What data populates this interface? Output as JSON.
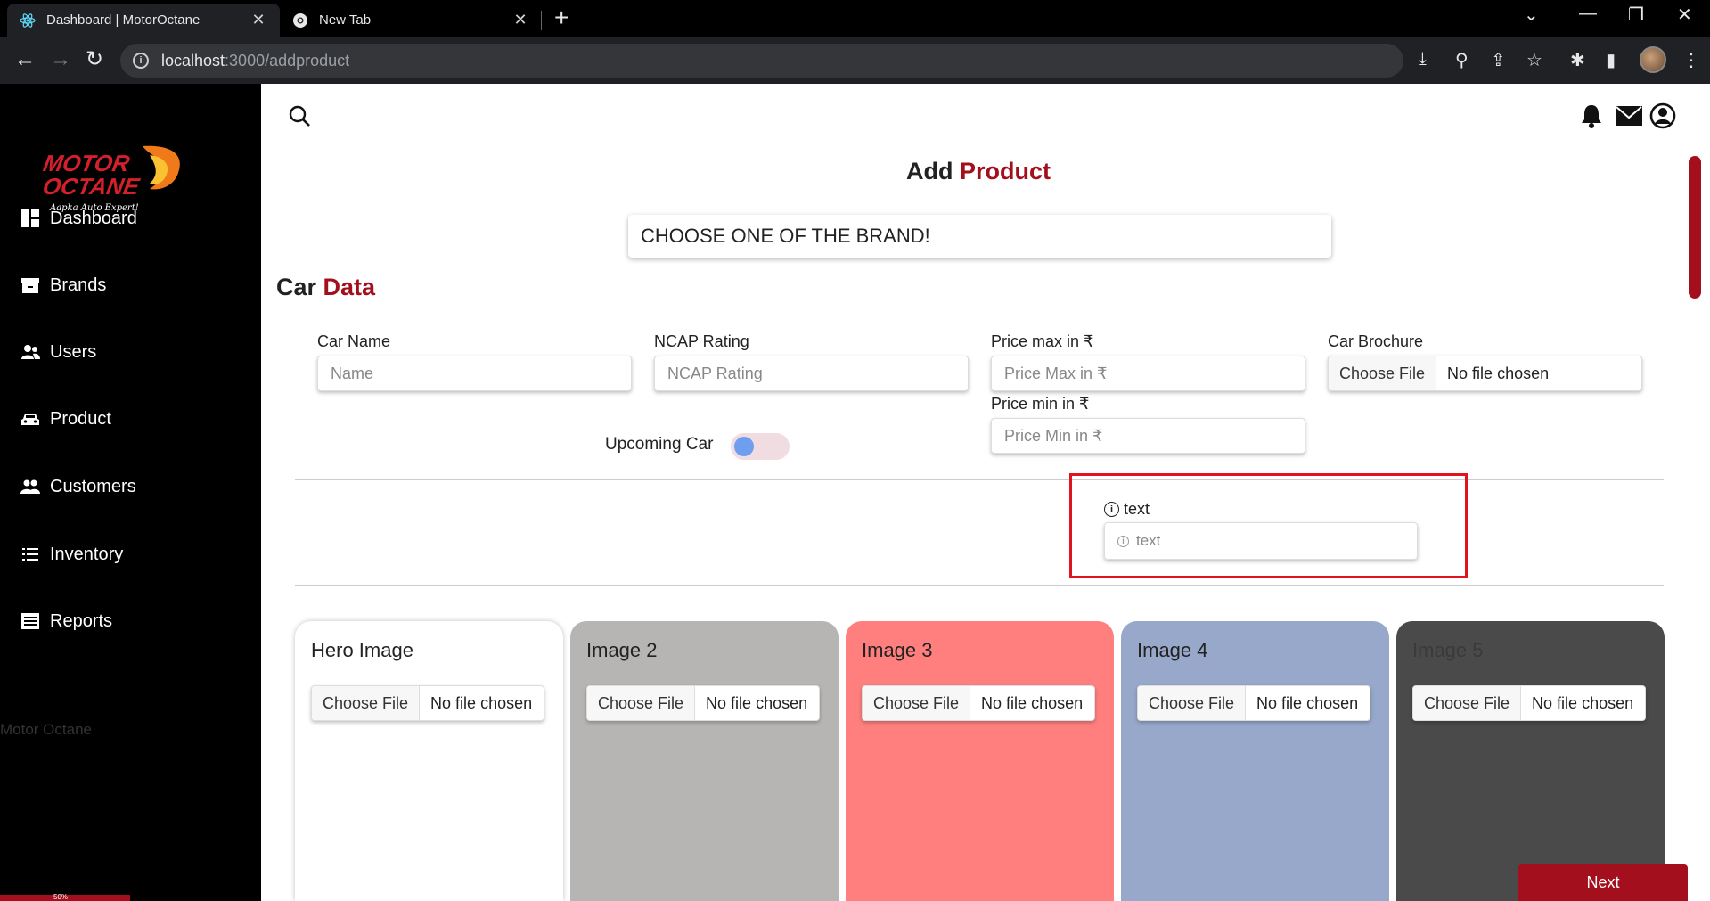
{
  "browser": {
    "tabs": [
      {
        "title": "Dashboard | MotorOctane",
        "active": true
      },
      {
        "title": "New Tab",
        "active": false
      }
    ],
    "url_host": "localhost",
    "url_rest": ":3000/addproduct"
  },
  "sidebar": {
    "items": [
      {
        "label": "Dashboard",
        "icon": "dashboard-icon"
      },
      {
        "label": "Brands",
        "icon": "archive-icon"
      },
      {
        "label": "Users",
        "icon": "users-icon"
      },
      {
        "label": "Product",
        "icon": "car-icon"
      },
      {
        "label": "Customers",
        "icon": "customers-icon"
      },
      {
        "label": "Inventory",
        "icon": "list-icon"
      },
      {
        "label": "Reports",
        "icon": "reports-icon"
      }
    ],
    "footer": "Motor Octane",
    "progress_label": "50%",
    "progress_fraction": 0.5
  },
  "header": {
    "title_part1": "Add",
    "title_part2": "Product"
  },
  "brand_select": {
    "value": "CHOOSE ONE OF THE BRAND!"
  },
  "section": {
    "title_part1": "Car",
    "title_part2": "Data"
  },
  "fields": {
    "car_name": {
      "label": "Car Name",
      "placeholder": "Name"
    },
    "ncap": {
      "label": "NCAP Rating",
      "placeholder": "NCAP Rating"
    },
    "price_max": {
      "label": "Price max in ₹",
      "placeholder": "Price Max in ₹"
    },
    "price_min": {
      "label": "Price min in ₹",
      "placeholder": "Price Min in ₹"
    },
    "brochure": {
      "label": "Car Brochure",
      "button": "Choose File",
      "value": "No file chosen"
    },
    "upcoming": {
      "label": "Upcoming Car",
      "checked": false
    },
    "text": {
      "label": "text",
      "placeholder": "text"
    }
  },
  "images": [
    {
      "title": "Hero Image",
      "button": "Choose File",
      "value": "No file chosen",
      "bg": "#ffffff"
    },
    {
      "title": "Image 2",
      "button": "Choose File",
      "value": "No file chosen",
      "bg": "#b7b5b4"
    },
    {
      "title": "Image 3",
      "button": "Choose File",
      "value": "No file chosen",
      "bg": "#ff7f7f"
    },
    {
      "title": "Image 4",
      "button": "Choose File",
      "value": "No file chosen",
      "bg": "#97a8cb"
    },
    {
      "title": "Image 5",
      "button": "Choose File",
      "value": "No file chosen",
      "bg": "#4a4a4a"
    }
  ],
  "next_label": "Next",
  "colors": {
    "accent": "#a30f1c",
    "highlight": "#e0141e"
  }
}
